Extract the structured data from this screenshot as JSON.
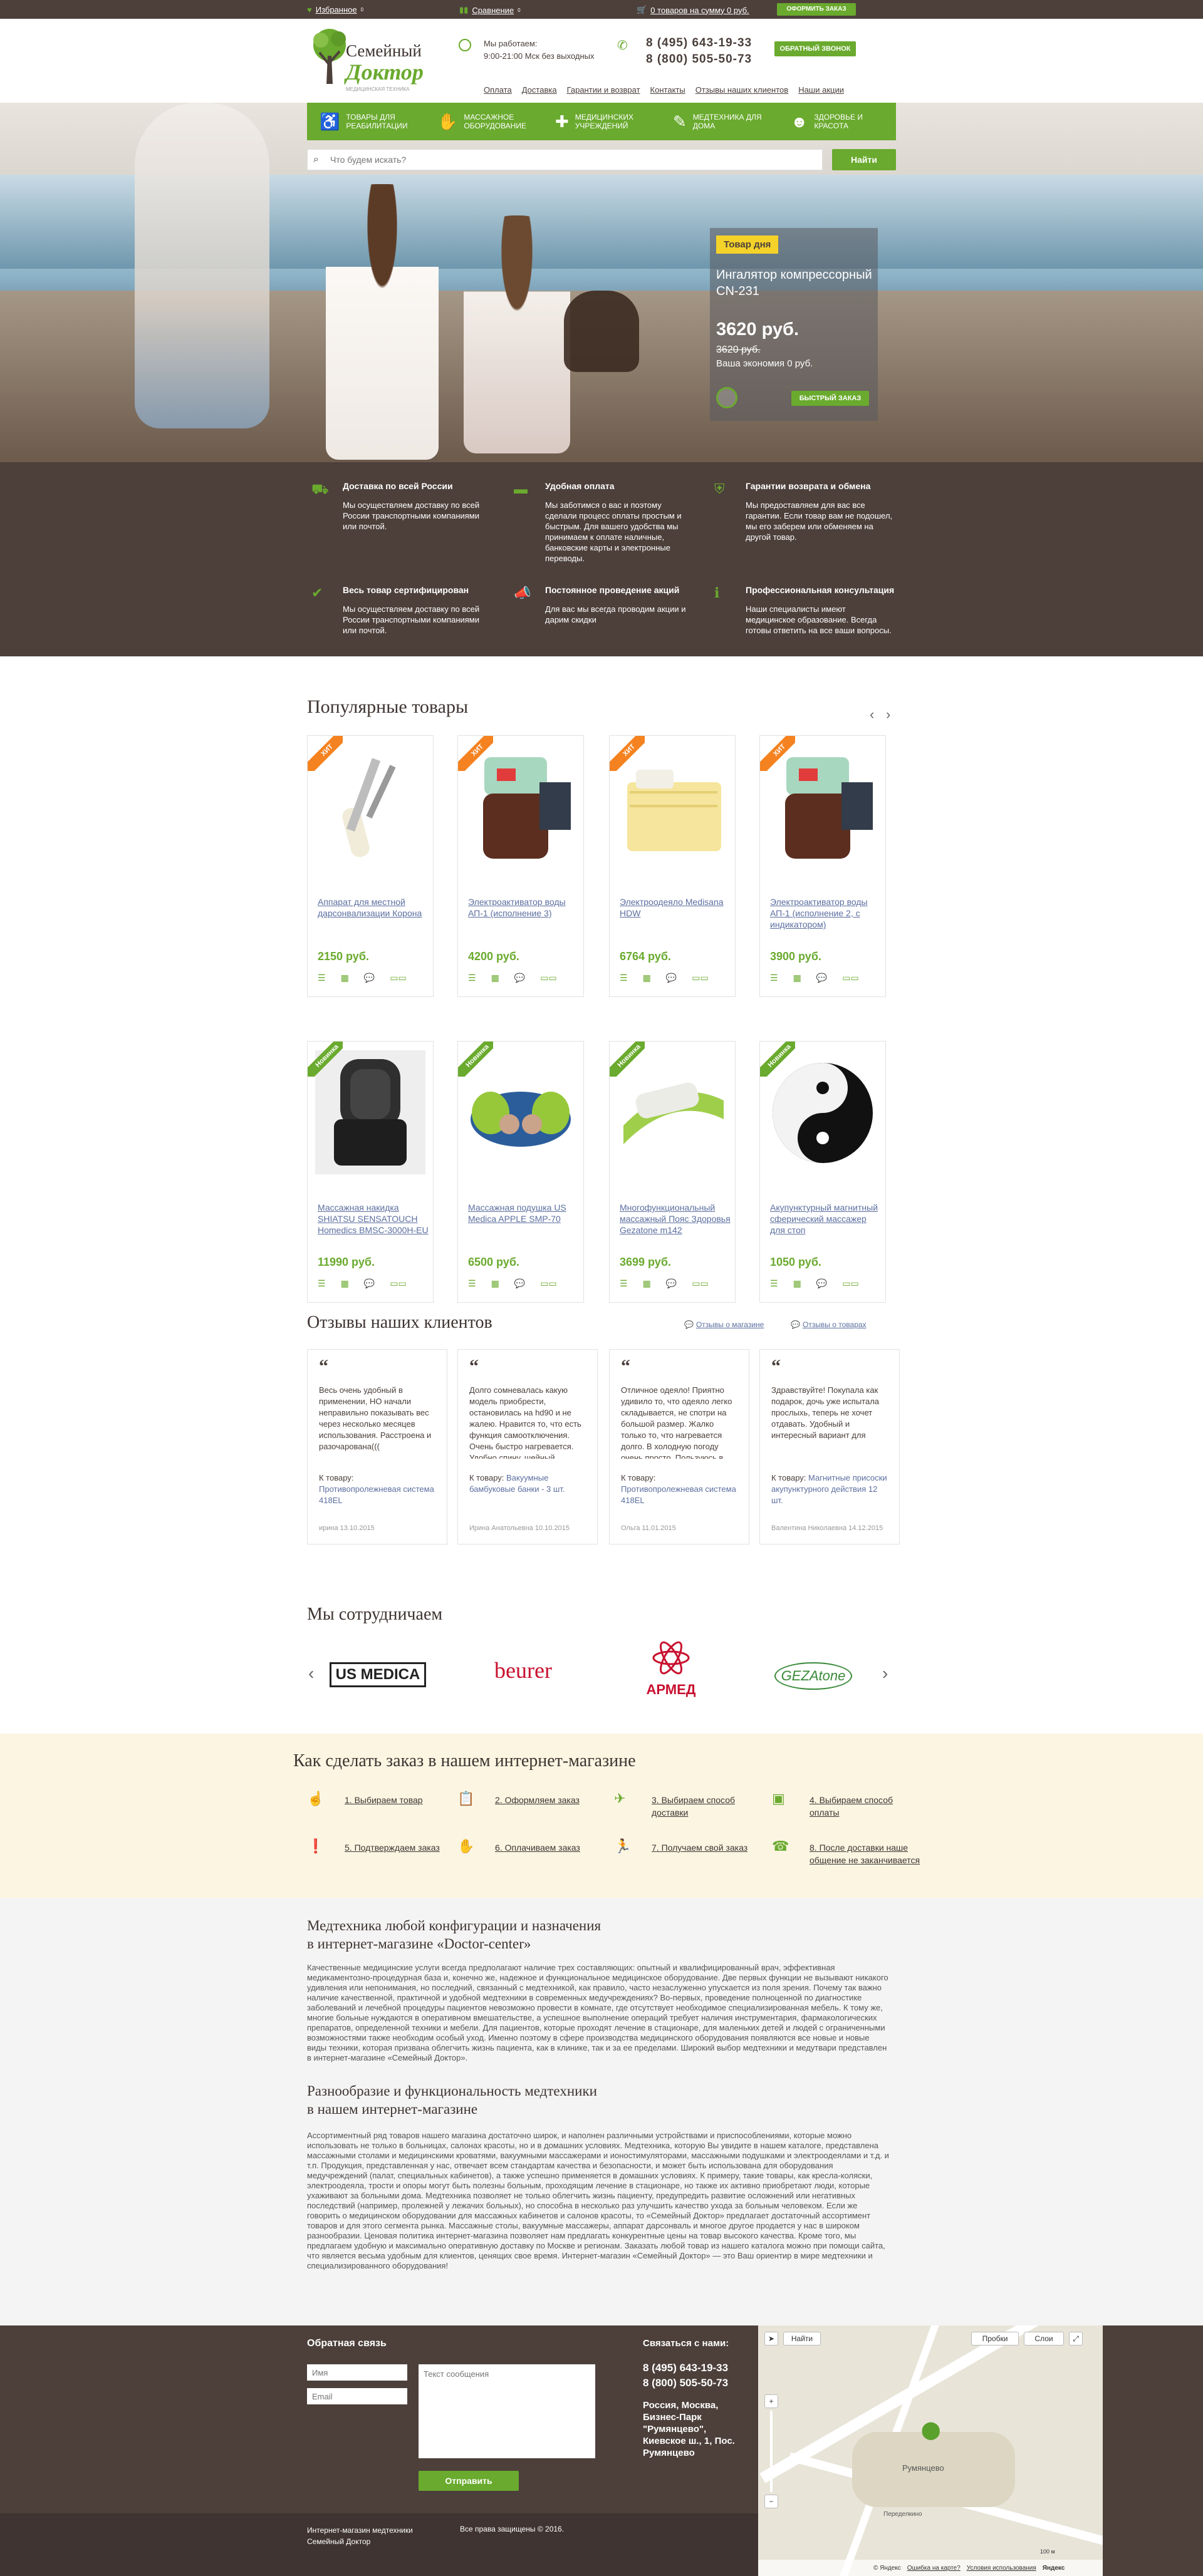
{
  "topbar": {
    "favorites": "Избранное",
    "favorites_count": "0",
    "compare": "Сравнение",
    "compare_count": "0",
    "cart": "0 товаров на сумму 0 руб.",
    "checkout": "ОФОРМИТЬ ЗАКАЗ"
  },
  "header": {
    "logo_line1": "Семейный",
    "logo_line2": "Доктор",
    "logo_tagline": "МЕДИЦИНСКАЯ ТЕХНИКА",
    "hours_label": "Мы работаем:",
    "hours_value": "9:00-21:00 Мск без выходных",
    "phone1": "8 (495) 643-19-33",
    "phone2": "8 (800) 505-50-73",
    "callback": "ОБРАТНЫЙ ЗВОНОК",
    "menu": [
      "Оплата",
      "Доставка",
      "Гарантии и возврат",
      "Контакты",
      "Отзывы наших клиентов",
      "Наши акции"
    ]
  },
  "categories": [
    {
      "label": "ТОВАРЫ ДЛЯ РЕАБИЛИТАЦИИ",
      "icon": "wheelchair-icon"
    },
    {
      "label": "МАССАЖНОЕ ОБОРУДОВАНИЕ",
      "icon": "massage-icon"
    },
    {
      "label": "МЕДИЦИНСКИХ УЧРЕЖДЕНИЙ",
      "icon": "hospital-icon"
    },
    {
      "label": "МЕДТЕХНИКА ДЛЯ ДОМА",
      "icon": "thermometer-icon"
    },
    {
      "label": "ЗДОРОВЬЕ И КРАСОТА",
      "icon": "person-icon"
    }
  ],
  "search": {
    "placeholder": "Что будем искать?",
    "button": "Найти"
  },
  "deal": {
    "tag": "Товар дня",
    "name": "Ингалятор компрессорный CN-231",
    "price": "3620 руб.",
    "old_price": "3620 руб.",
    "economy": "Ваша экономия 0 руб.",
    "buy": "БЫСТРЫЙ ЗАКАЗ"
  },
  "features": [
    {
      "title": "Доставка по всей России",
      "text": "Мы осуществляем доставку по всей России транспортными компаниями или почтой.",
      "icon": "truck-icon"
    },
    {
      "title": "Удобная оплата",
      "text": "Мы заботимся о вас и поэтому сделали процесс оплаты простым и быстрым. Для вашего удобства мы принимаем к оплате наличные, банковские карты и электронные переводы.",
      "icon": "card-icon"
    },
    {
      "title": "Гарантии возврата и обмена",
      "text": "Мы предоставляем для вас все гарантии. Если товар вам не подошел, мы его заберем или обменяем на другой товар.",
      "icon": "shield-icon"
    },
    {
      "title": "Весь товар сертифицирован",
      "text": "Мы осуществляем доставку по всей России транспортными компаниями или почтой.",
      "icon": "certificate-icon"
    },
    {
      "title": "Постоянное проведение акций",
      "text": "Для вас мы всегда проводим акции и дарим скидки",
      "icon": "megaphone-icon"
    },
    {
      "title": "Профессиональная консультация",
      "text": "Наши специалисты имеют медицинское образование. Всегда готовы ответить на все ваши вопросы.",
      "icon": "info-icon"
    }
  ],
  "popular": {
    "title": "Популярные товары",
    "items": [
      {
        "badge": "ХИТ",
        "name": "Аппарат для местной дарсонвализации Корона",
        "price": "2150 руб."
      },
      {
        "badge": "ХИТ",
        "name": "Электроактиватор воды АП-1 (исполнение 3)",
        "price": "4200 руб."
      },
      {
        "badge": "ХИТ",
        "name": "Электроодеяло Medisana HDW",
        "price": "6764 руб."
      },
      {
        "badge": "ХИТ",
        "name": "Электроактиватор воды АП-1 (исполнение 2, с индикатором)",
        "price": "3900 руб."
      },
      {
        "badge": "Новинка",
        "name": "Массажная накидка SHIATSU SENSATOUCH Homedics BMSC-3000H-EU",
        "price": "11990 руб."
      },
      {
        "badge": "Новинка",
        "name": "Массажная подушка US Medica APPLE SMP-70",
        "price": "6500 руб."
      },
      {
        "badge": "Новинка",
        "name": "Многофункциональный массажный Пояс Здоровья Gezatone m142",
        "price": "3699 руб."
      },
      {
        "badge": "Новинка",
        "name": "Акупунктурный магнитный сферический массажер для стоп",
        "price": "1050 руб."
      }
    ]
  },
  "reviews": {
    "title": "Отзывы наших клиентов",
    "link1": "Отзывы о магазине",
    "link2": "Отзывы о товарах",
    "items": [
      {
        "text": "Весь очень удобный в применении, НО начали неправильно показывать вес через несколько месяцев использования. Расстроена и разочарована(((",
        "product_label": "К товару:",
        "product": "Противопролежневая система 418EL",
        "author": "ирина 13.10.2015"
      },
      {
        "text": "Долго сомневалась какую модель приобрести, остановилась на hd90 и не жалею. Нравится то, что есть функция самоотключения. Очень быстро нагревается. Удобно спину, шейный",
        "product_label": "К товару:",
        "product": "Вакуумные бамбуковые банки - 3 шт.",
        "author": "Ирина Анатольевна 10.10.2015"
      },
      {
        "text": "Отличное одеяло! Приятно удивило то, что одеяло легко складывается, не спотри на большой размер. Жалко только то, что нагревается долго. В холодную погоду очень просто. Пользуюсь в",
        "product_label": "К товару:",
        "product": "Противопролежневая система 418EL",
        "author": "Ольга 11.01.2015"
      },
      {
        "text": "Здравствуйте! Покупала как подарок, дочь уже испытала прослыхь, теперь не хочет отдавать. Удобный и интересный вариант для",
        "product_label": "К товару:",
        "product": "Магнитные присоски акупунктурного действия 12 шт.",
        "author": "Валентина Николаевна 14.12.2015"
      }
    ]
  },
  "partners": {
    "title": "Мы сотрудничаем",
    "logos": [
      "US MEDICA",
      "beurer",
      "АРМЕД",
      "GEZAtone"
    ]
  },
  "howto": {
    "title": "Как сделать заказ в нашем интернет-магазине",
    "steps": [
      {
        "label": "1. Выбираем товар",
        "icon": "hand-icon"
      },
      {
        "label": "2. Оформляем заказ",
        "icon": "clipboard-icon"
      },
      {
        "label": "3. Выбираем способ доставки",
        "icon": "plane-icon"
      },
      {
        "label": "4. Выбираем способ оплаты",
        "icon": "wallet-icon"
      },
      {
        "label": "5. Подтверждаем заказ",
        "icon": "info-icon"
      },
      {
        "label": "6. Оплачиваем заказ",
        "icon": "hand-money-icon"
      },
      {
        "label": "7. Получаем свой заказ",
        "icon": "courier-icon"
      },
      {
        "label": "8. После доставки наше общение не заканчивается",
        "icon": "phone-icon"
      }
    ]
  },
  "seo": {
    "h1a": "Медтехника любой конфигурации и назначения",
    "h1b": "в интернет-магазине «Doctor-center»",
    "p1": "Качественные медицинские услуги всегда предполагают наличие трех составляющих: опытный и квалифицированный врач, эффективная медикаментозно-процедурная база и, конечно же, надежное и функциональное медицинское оборудование. Две первых функции не вызывают никакого удивления или непонимания, но последний, связанный с медтехникой, как правило, часто незаслуженно упускается из поля зрения. Почему так важно наличие качественной, практичной и удобной медтехники в современных медучреждениях? Во-первых, проведение полноценной по диагностике заболеваний и лечебной процедуры пациентов невозможно провести в комнате, где отсутствует необходимое специализированная мебель. К тому же, многие больные нуждаются в оперативном вмешательстве, а успешное выполнение операций требует наличия инструментария, фармакологических препаратов, определенной техники и мебели. Для пациентов, которые проходят лечение в стационаре, для маленьких детей и людей с ограниченными возможностями также необходим особый уход. Именно поэтому в сфере производства медицинского оборудования появляются все новые и новые виды техники, которая призвана облегчить жизнь пациента, как в клинике, так и за ее пределами. Широкий выбор медтехники и медутвари представлен в интернет-магазине «Семейный Доктор».",
    "h2a": "Разнообразие и функциональность медтехники",
    "h2b": "в нашем интернет-магазине",
    "p2": "Ассортиментный ряд товаров нашего магазина достаточно широк, и наполнен различными устройствами и приспособлениями, которые можно использовать не только в больницах, салонах красоты, но и в домашних условиях. Медтехника, которую Вы увидите в нашем каталоге, представлена массажными столами и медицинскими кроватями, вакуумными массажерами и ионостимуляторами, массажными подушками и электроодеялами и т.д. и т.п. Продукция, представленная у нас, отвечает всем стандартам качества и безопасности, и может быть использована для оборудования медучреждений (палат, специальных кабинетов), а также успешно применяется в домашних условиях. К примеру, такие товары, как кресла-коляски, электроодеяла, трости и опоры могут быть полезны больным, проходящим лечение в стационаре, но также их активно приобретают люди, которые ухаживают за больными дома. Медтехника позволяет не только облегчить жизнь пациенту, предупредить развитие осложнений или негативных последствий (например, пролежней у лежачих больных), но способна в несколько раз улучшить качество ухода за больным человеком. Если же говорить о медицинском оборудовании для массажных кабинетов и салонов красоты, то «Семейный Доктор» предлагает достаточный ассортимент товаров и для этого сегмента рынка. Массажные столы, вакуумные массажеры, аппарат дарсонваль и многое другое продается у нас в широком разнообразии. Ценовая политика интернет-магазина позволяет нам предлагать конкурентные цены на товар высокого качества. Кроме того, мы предлагаем удобную и максимально оперативную доставку по Москве и регионам. Заказать любой товар из нашего каталога можно при помощи сайта, что является весьма удобным для клиентов, ценящих свое время. Интернет-магазин «Семейный Доктор» — это Ваш ориентир в мире медтехники и специализированного оборудования!"
  },
  "footer": {
    "feedback_title": "Обратная связь",
    "name_ph": "Имя",
    "email_ph": "Email",
    "message_ph": "Текст сообщения",
    "send": "Отправить",
    "contacts_title": "Связаться с нами:",
    "phone1": "8 (495) 643-19-33",
    "phone2": "8 (800) 505-50-73",
    "address": "Россия, Москва, Бизнес-Парк \"Румянцево\", Киевское ш., 1, Пос. Румянцево",
    "copy_left1": "Интернет-магазин медтехники",
    "copy_left2": "Семейный Доктор",
    "copy_right": "Все права защищены © 2016."
  },
  "map": {
    "find": "Найти",
    "traffic": "Пробки",
    "layers": "Слои",
    "place": "Румянцево",
    "place2": "Переделкино",
    "scale": "100 м",
    "yandex": "© Яндекс",
    "err": "Ошибка на карте?",
    "terms": "Условия использования",
    "brand": "Яндекс"
  }
}
